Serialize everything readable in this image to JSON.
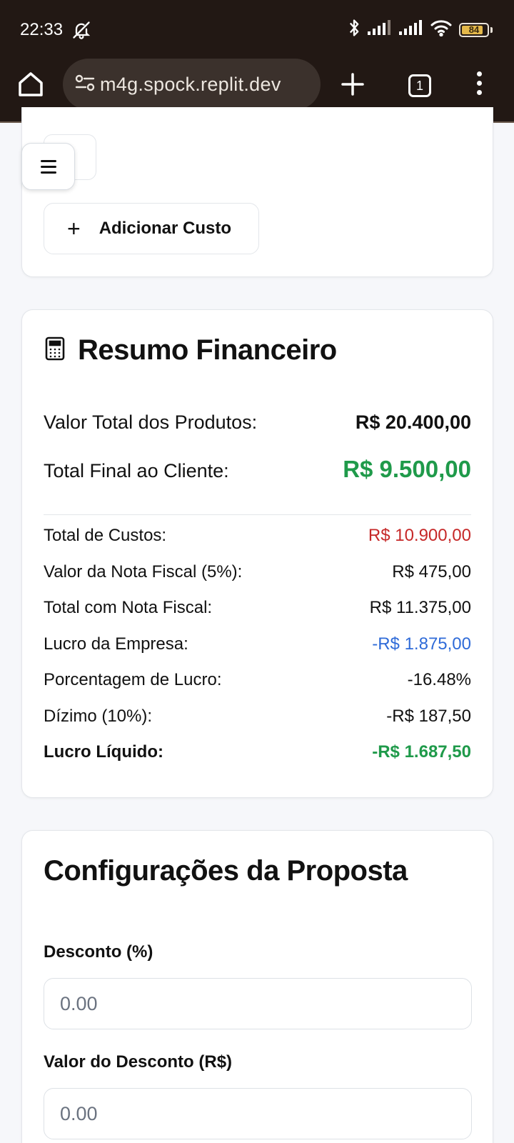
{
  "status_bar": {
    "time": "22:33",
    "battery": "84",
    "battery_level": 0.84,
    "icons": [
      "bell-off-icon",
      "bluetooth-icon",
      "signal-icon",
      "signal-icon",
      "wifi-icon",
      "battery-icon"
    ]
  },
  "browser": {
    "url": "m4g.spock.replit.dev",
    "tab_count": "1",
    "icons": [
      "home-icon",
      "site-settings-icon",
      "plus-icon",
      "tabs-icon",
      "more-vert-icon"
    ]
  },
  "costs_card": {
    "add_cost_label": "Adicionar Custo"
  },
  "summary": {
    "title": "Resumo Financeiro",
    "total_products_label": "Valor Total dos Produtos:",
    "total_products_value": "R$ 20.400,00",
    "final_total_label": "Total Final ao Cliente:",
    "final_total_value": "R$ 9.500,00",
    "rows": [
      {
        "label": "Total de Custos:",
        "value": "R$ 10.900,00"
      },
      {
        "label": "Valor da Nota Fiscal (5%):",
        "value": "R$ 475,00"
      },
      {
        "label": "Total com Nota Fiscal:",
        "value": "R$ 11.375,00"
      },
      {
        "label": "Lucro da Empresa:",
        "value": "-R$ 1.875,00"
      },
      {
        "label": "Porcentagem de Lucro:",
        "value": "-16.48%"
      },
      {
        "label": "Dízimo (10%):",
        "value": "-R$ 187,50"
      },
      {
        "label": "Lucro Líquido:",
        "value": "-R$ 1.687,50"
      }
    ]
  },
  "config": {
    "title": "Configurações da Proposta",
    "discount_percent_label": "Desconto (%)",
    "discount_percent_placeholder": "0.00",
    "discount_value_label": "Valor do Desconto (R$)",
    "discount_value_placeholder": "0.00"
  },
  "colors": {
    "chrome_bg": "#221814",
    "green": "#1f9a4a",
    "red": "#c62828",
    "blue": "#2f6bd8"
  }
}
